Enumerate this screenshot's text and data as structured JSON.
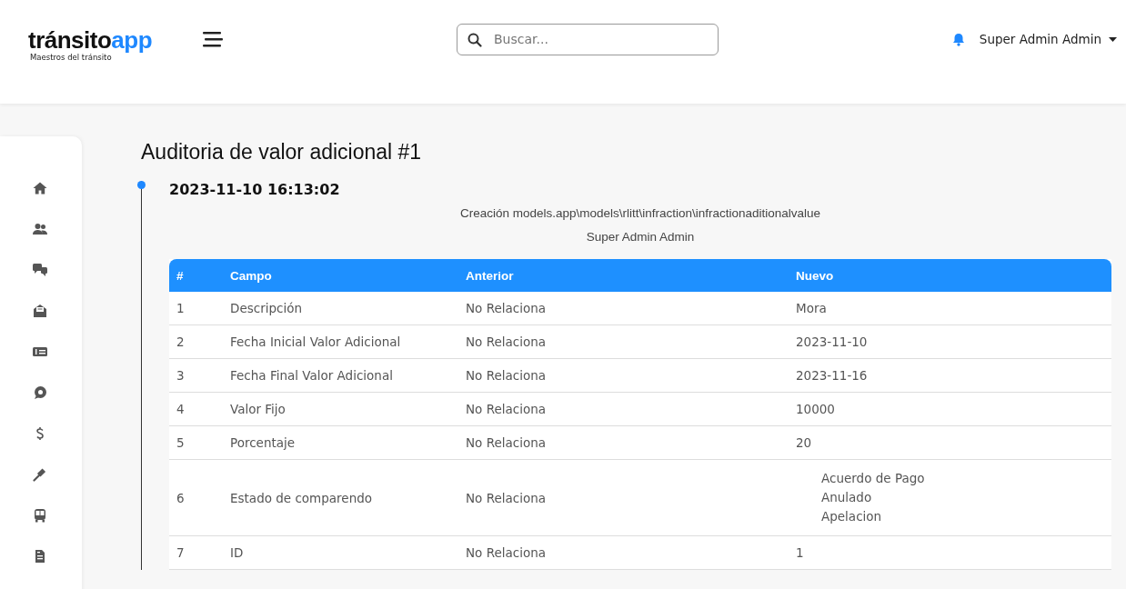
{
  "header": {
    "logo": {
      "word": "tránsito",
      "accent": "app",
      "tagline": "Maestros del tránsito"
    },
    "search": {
      "placeholder": "Buscar..."
    },
    "user": {
      "name": "Super Admin Admin"
    }
  },
  "page": {
    "title": "Auditoria de valor adicional #1"
  },
  "timeline": [
    {
      "date": "2023-11-10 16:13:02",
      "action": "Creación models.app\\models\\rlitt\\infraction\\infractionaditionalvalue",
      "user": "Super Admin Admin",
      "table": {
        "columns": [
          "#",
          "Campo",
          "Anterior",
          "Nuevo"
        ],
        "rows": [
          {
            "n": "1",
            "campo": "Descripción",
            "anterior": "No Relaciona",
            "kind": "text",
            "nuevo": [
              "Mora"
            ]
          },
          {
            "n": "2",
            "campo": "Fecha Inicial Valor Adicional",
            "anterior": "No Relaciona",
            "kind": "text",
            "nuevo": [
              "2023-11-10"
            ]
          },
          {
            "n": "3",
            "campo": "Fecha Final Valor Adicional",
            "anterior": "No Relaciona",
            "kind": "text",
            "nuevo": [
              "2023-11-16"
            ]
          },
          {
            "n": "4",
            "campo": "Valor Fijo",
            "anterior": "No Relaciona",
            "kind": "text",
            "nuevo": [
              "10000"
            ]
          },
          {
            "n": "5",
            "campo": "Porcentaje",
            "anterior": "No Relaciona",
            "kind": "text",
            "nuevo": [
              "20"
            ]
          },
          {
            "n": "6",
            "campo": "Estado de comparendo",
            "anterior": "No Relaciona",
            "kind": "list",
            "nuevo": [
              "Acuerdo de Pago",
              "Anulado",
              "Apelacion"
            ]
          },
          {
            "n": "7",
            "campo": "ID",
            "anterior": "No Relaciona",
            "kind": "text",
            "nuevo": [
              "1"
            ]
          }
        ]
      }
    }
  ]
}
